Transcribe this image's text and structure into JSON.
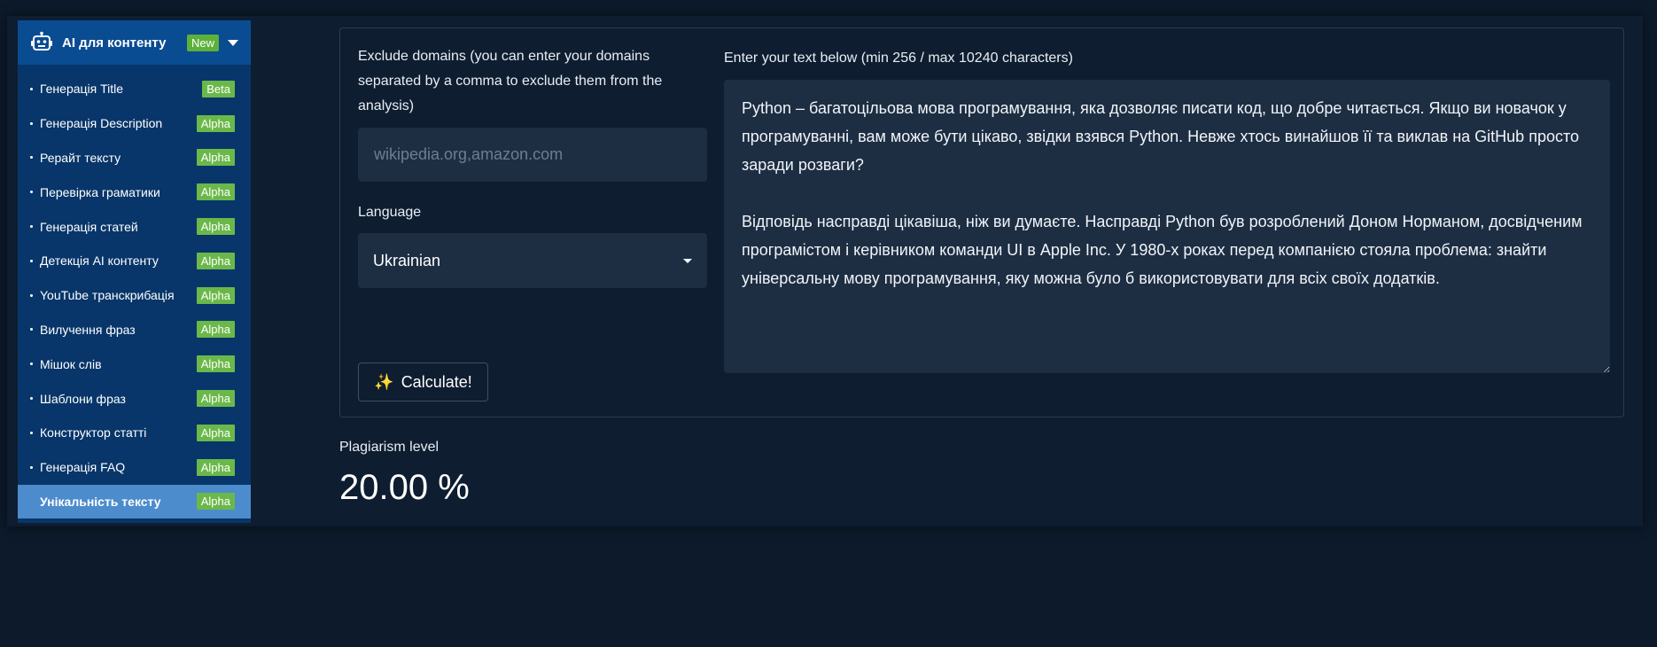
{
  "sidebar": {
    "title": "AI для контенту",
    "new_badge": "New",
    "items": [
      {
        "label": "Генерація Title",
        "badge": "Beta"
      },
      {
        "label": "Генерація Description",
        "badge": "Alpha"
      },
      {
        "label": "Рерайт тексту",
        "badge": "Alpha"
      },
      {
        "label": "Перевірка граматики",
        "badge": "Alpha"
      },
      {
        "label": "Генерація статей",
        "badge": "Alpha"
      },
      {
        "label": "Детекція AI контенту",
        "badge": "Alpha"
      },
      {
        "label": "YouTube транскрибація",
        "badge": "Alpha"
      },
      {
        "label": "Вилучення фраз",
        "badge": "Alpha"
      },
      {
        "label": "Мішок слів",
        "badge": "Alpha"
      },
      {
        "label": "Шаблони фраз",
        "badge": "Alpha"
      },
      {
        "label": "Конструктор статті",
        "badge": "Alpha"
      },
      {
        "label": "Генерація FAQ",
        "badge": "Alpha"
      },
      {
        "label": "Унікальність тексту",
        "badge": "Alpha"
      }
    ]
  },
  "form": {
    "exclude_label": "Exclude domains (you can enter your domains separated by a comma to exclude them from the analysis)",
    "exclude_placeholder": "wikipedia.org,amazon.com",
    "exclude_value": "",
    "language_label": "Language",
    "language_value": "Ukrainian",
    "text_label": "Enter your text below (min 256 / max 10240 characters)",
    "text_value": "Python – багатоцільова мова програмування, яка дозволяє писати код, що добре читається. Якщо ви новачок у програмуванні, вам може бути цікаво, звідки взявся Python. Невже хтось винайшов її та виклав на GitHub просто заради розваги?\n\nВідповідь насправді цікавіша, ніж ви думаєте. Насправді Python був розроблений Доном Норманом, досвідченим програмістом і керівником команди UI в Apple Inc. У 1980-х роках перед компанією стояла проблема: знайти універсальну мову програмування, яку можна було б використовувати для всіх своїх додатків.",
    "calculate_label": "Calculate!"
  },
  "result": {
    "label": "Plagiarism level",
    "value": "20.00 %"
  },
  "colors": {
    "background": "#0c1a2b",
    "sidebar": "#08366a",
    "sidebar_header": "#0a4c92",
    "active_item": "#4c8ccc",
    "badge": "#6bb84a",
    "input_bg": "#1d2e43"
  }
}
